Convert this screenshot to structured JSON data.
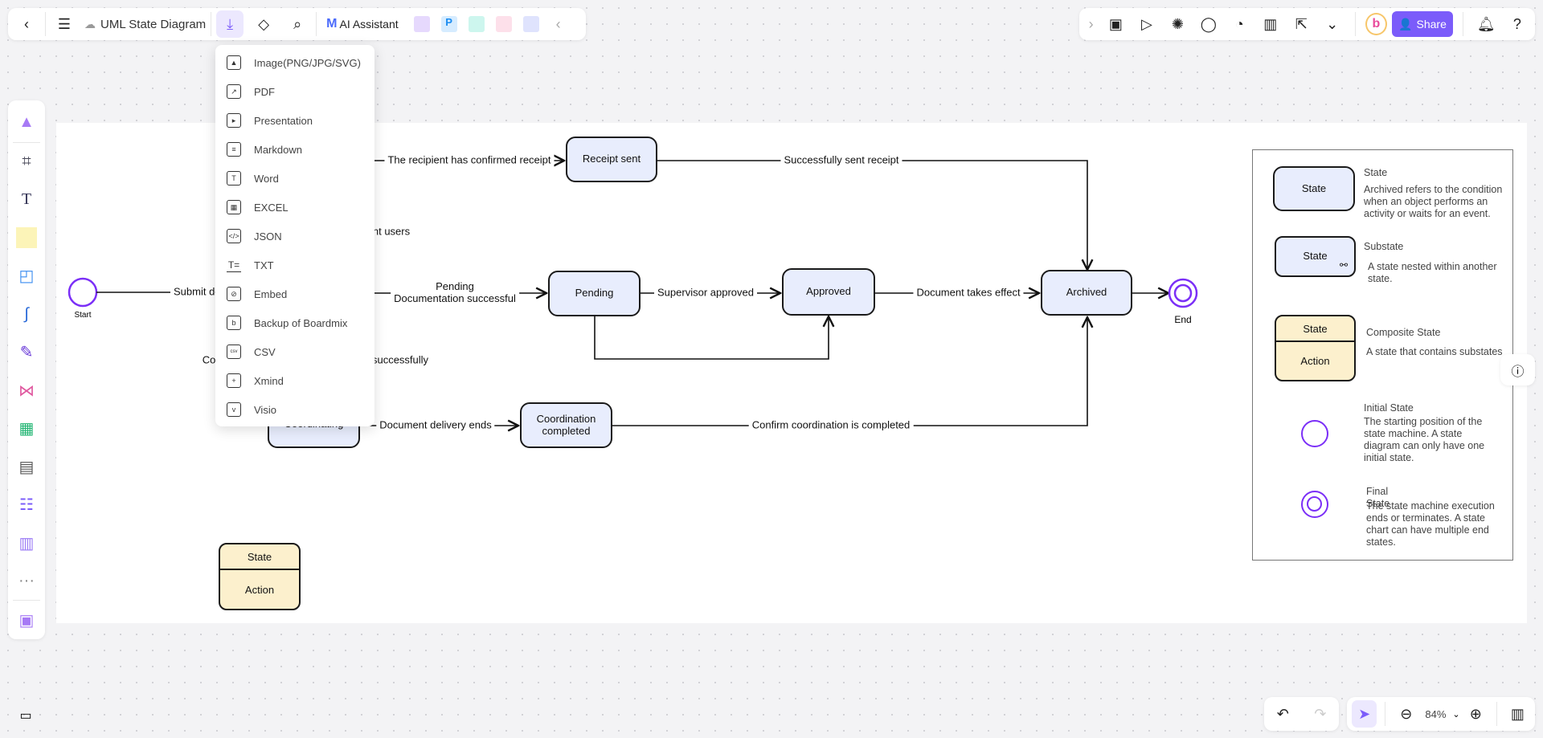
{
  "topbar": {
    "title": "UML State Diagram",
    "ai_label": "AI Assistant"
  },
  "topright": {
    "share_label": "Share"
  },
  "export_menu": {
    "items": [
      "Image(PNG/JPG/SVG)",
      "PDF",
      "Presentation",
      "Markdown",
      "Word",
      "EXCEL",
      "JSON",
      "TXT",
      "Embed",
      "Backup of Boardmix",
      "CSV",
      "Xmind",
      "Visio"
    ]
  },
  "diagram": {
    "start_label": "Start",
    "end_label": "End",
    "nodes": {
      "receipt_sent": "Receipt sent",
      "pending": "Pending",
      "approved": "Approved",
      "archived": "Archived",
      "coordinating": "Coordinating",
      "coordination_completed": "Coordination completed"
    },
    "edges": {
      "submit": "Submit document infor",
      "confirmed_receipt": "The recipient has confirmed receipt",
      "sent_receipt": "Successfully sent receipt",
      "users": "nt users",
      "pending_doc": "Pending\nDocumentation successful",
      "supervisor": "Supervisor approved",
      "takes_effect": "Document takes effect",
      "co": "Co",
      "successfully": "successfully",
      "delivery_ends": "Document delivery ends",
      "confirm_coord": "Confirm coordination is completed"
    },
    "composite": {
      "state": "State",
      "action": "Action"
    }
  },
  "legend": {
    "state": {
      "box": "State",
      "title": "State",
      "desc": "Archived refers to the condition when an object performs an activity or waits for an event."
    },
    "substate": {
      "box": "State",
      "title": "Substate",
      "desc": "A state nested within another state."
    },
    "composite": {
      "box_state": "State",
      "box_action": "Action",
      "title": "Composite State",
      "desc": "A state that contains substates"
    },
    "initial": {
      "title": "Initial State",
      "desc": "The starting position of the state machine. A state diagram can only have one initial state."
    },
    "final": {
      "title": "Final State",
      "desc": "The state machine execution ends or terminates. A state chart can have multiple end states."
    }
  },
  "bottombar": {
    "zoom": "84%"
  },
  "colors": {
    "accent": "#7b5cfa",
    "state_fill": "#e8edfd",
    "composite_fill": "#fcf0cd",
    "circle": "#7b2ff7"
  }
}
